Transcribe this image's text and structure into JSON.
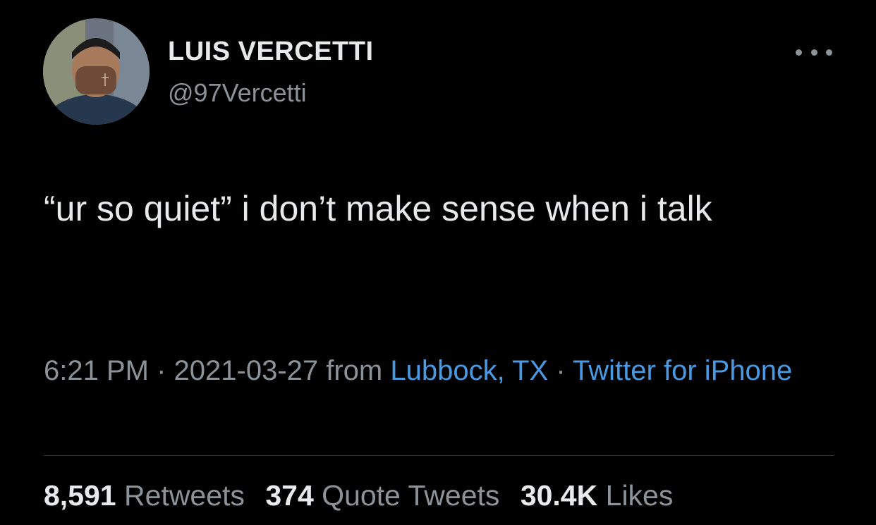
{
  "user": {
    "name": "LUIS VERCETTI",
    "handle": "@97Vercetti"
  },
  "tweet": {
    "text": "“ur so quiet” i don’t make sense when i talk",
    "time": "6:21 PM",
    "separator": " · ",
    "date": "2021-03-27",
    "from": " from ",
    "location": "Lubbock, TX",
    "client": "Twitter for iPhone"
  },
  "stats": {
    "retweets_count": "8,591",
    "retweets_label": "Retweets",
    "quotes_count": "374",
    "quotes_label": "Quote Tweets",
    "likes_count": "30.4K",
    "likes_label": "Likes"
  },
  "colors": {
    "background": "#000000",
    "primary_text": "#e7e9ea",
    "secondary_text": "#8b9298",
    "link": "#4a9ae3"
  },
  "icons": {
    "more": "more-horizontal-icon"
  }
}
